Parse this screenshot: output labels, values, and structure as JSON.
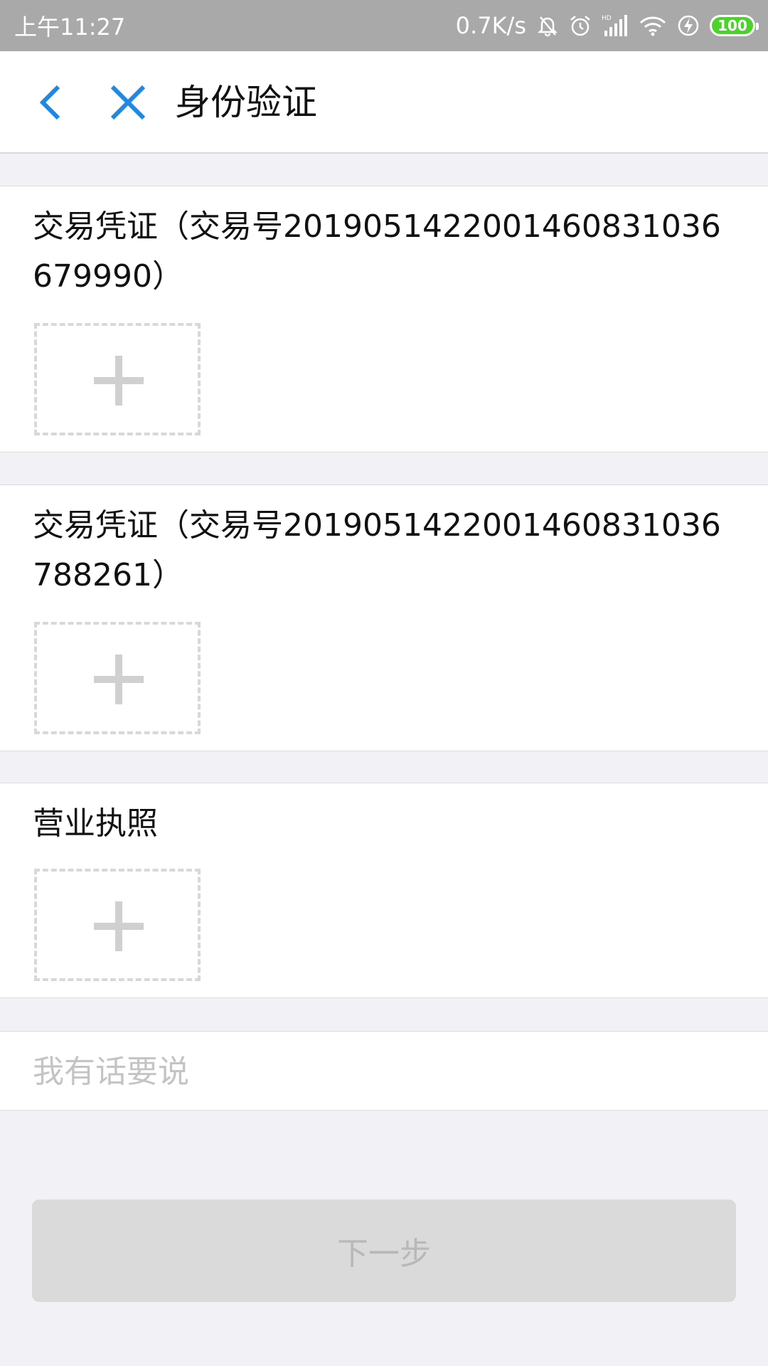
{
  "status_bar": {
    "time": "上午11:27",
    "net_speed": "0.7K/s",
    "icons": [
      "mute-bell-icon",
      "alarm-icon",
      "hd-signal-icon",
      "wifi-icon",
      "charging-icon",
      "battery-icon"
    ],
    "signal_tag": "HD",
    "battery_level": "100"
  },
  "nav": {
    "title": "身份验证",
    "back_icon": "chevron-left-icon",
    "close_icon": "close-icon",
    "accent_color": "#1e88e5"
  },
  "sections": [
    {
      "title": "交易凭证（交易号2019051422001460831036679990）",
      "upload_icon": "plus-icon"
    },
    {
      "title": "交易凭证（交易号2019051422001460831036788261）",
      "upload_icon": "plus-icon"
    },
    {
      "title": "营业执照",
      "upload_icon": "plus-icon"
    }
  ],
  "remark": {
    "placeholder": "我有话要说",
    "value": ""
  },
  "next_button": {
    "label": "下一步",
    "enabled": false
  }
}
